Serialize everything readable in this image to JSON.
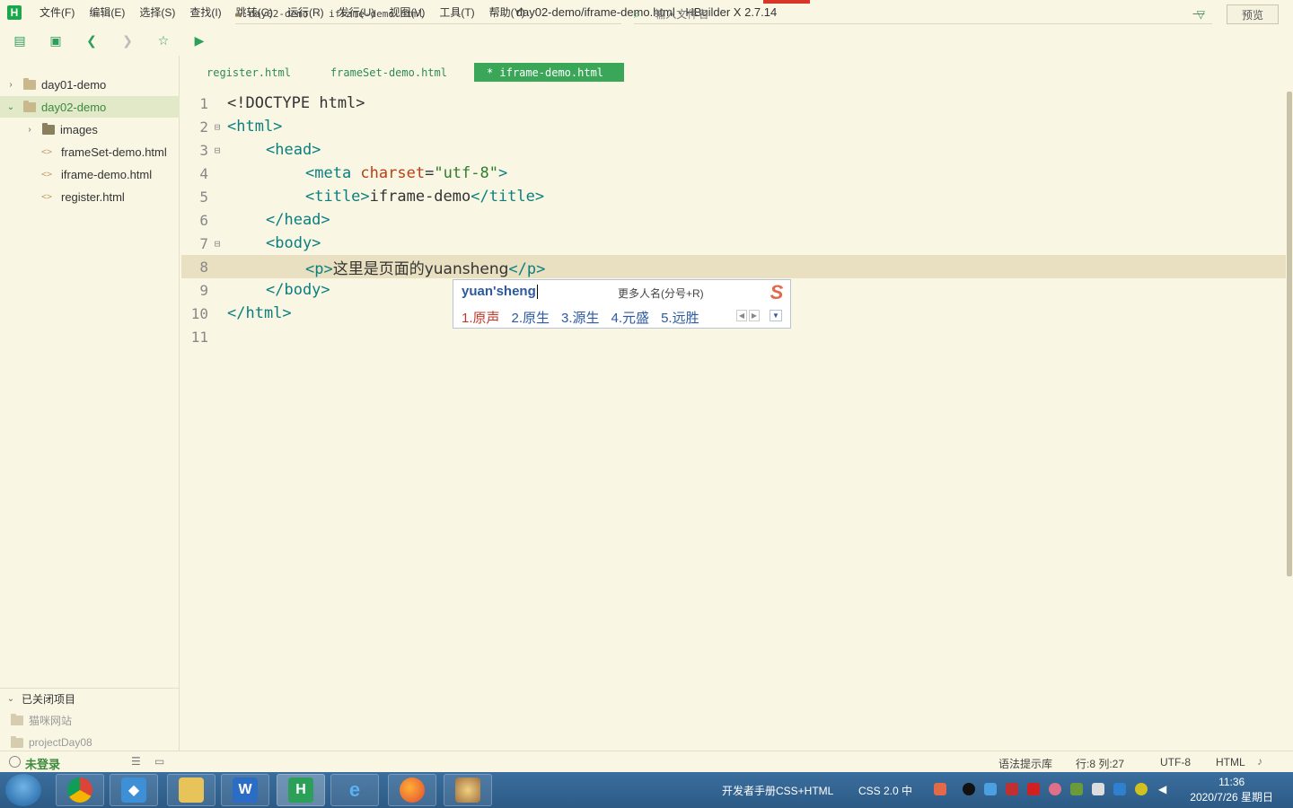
{
  "window": {
    "title": "day02-demo/iframe-demo.html - HBuilder X 2.7.14",
    "app_logo": "H"
  },
  "menu": [
    "文件(F)",
    "编辑(E)",
    "选择(S)",
    "查找(I)",
    "跳转(G)",
    "运行(R)",
    "发行(U)",
    "视图(V)",
    "工具(T)",
    "帮助(Y)"
  ],
  "toolbar": {
    "breadcrumb": [
      "day02-demo",
      "iframe-demo.html"
    ],
    "search_placeholder": "输入文件名",
    "preview_label": "预览"
  },
  "sidebar": {
    "projects": [
      {
        "label": "day01-demo",
        "expanded": false
      },
      {
        "label": "day02-demo",
        "expanded": true
      }
    ],
    "children": [
      {
        "label": "images",
        "type": "folder"
      },
      {
        "label": "frameSet-demo.html",
        "type": "file"
      },
      {
        "label": "iframe-demo.html",
        "type": "file"
      },
      {
        "label": "register.html",
        "type": "file"
      }
    ],
    "closed_title": "已关闭项目",
    "closed_projects": [
      "猫咪网站",
      "projectDay08"
    ]
  },
  "tabs": [
    {
      "label": "register.html",
      "active": false
    },
    {
      "label": "frameSet-demo.html",
      "active": false
    },
    {
      "label": "* iframe-demo.html",
      "active": true
    }
  ],
  "editor": {
    "line_numbers": [
      "1",
      "2",
      "3",
      "4",
      "5",
      "6",
      "7",
      "8",
      "9",
      "10",
      "11"
    ],
    "current_line": 8,
    "code": {
      "l1": "<!DOCTYPE html>",
      "l2_tag": "<html>",
      "l3_tag": "<head>",
      "l4_open": "<meta ",
      "l4_attr": "charset",
      "l4_eq": "=",
      "l4_str": "\"utf-8\"",
      "l4_close": ">",
      "l5_open": "<title>",
      "l5_text": "iframe-demo",
      "l5_close": "</title>",
      "l6_tag": "</head>",
      "l7_tag": "<body>",
      "l8_open": "<p>",
      "l8_text": "这里是页面的yuansheng",
      "l8_close": "</p>",
      "l9_tag": "</body>",
      "l10_tag": "</html>"
    }
  },
  "ime": {
    "input": "yuan'sheng",
    "hint": "更多人名(分号+R)",
    "candidates": [
      "1.原声",
      "2.原生",
      "3.源生",
      "4.元盛",
      "5.远胜"
    ]
  },
  "statusbar": {
    "user": "未登录",
    "syntax_hint": "语法提示库",
    "position": "行:8  列:27",
    "encoding": "UTF-8",
    "language": "HTML"
  },
  "taskbar": {
    "tray_text_1": "开发者手册CSS+HTML",
    "tray_text_2": "CSS 2.0 中",
    "time": "11:36",
    "date": "2020/7/26 星期日"
  },
  "colors": {
    "background": "#faf6e4",
    "accent": "#3aa657",
    "tag": "#0a7f7f",
    "attr": "#b83f14",
    "string": "#2d7d2d"
  }
}
